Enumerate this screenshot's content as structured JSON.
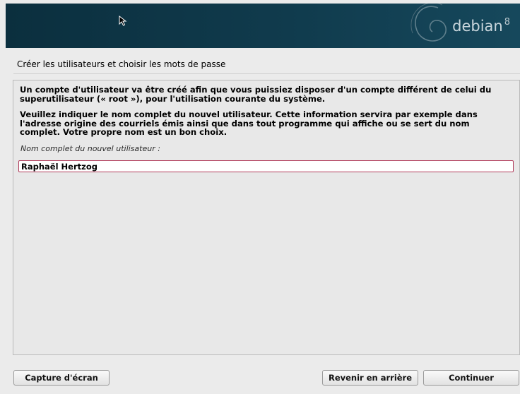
{
  "banner": {
    "logo_text": "debian",
    "logo_version": "8",
    "background": "#103b4d"
  },
  "page": {
    "title": "Créer les utilisateurs et choisir les mots de passe"
  },
  "content": {
    "paragraph1": "Un compte d'utilisateur va être créé afin que vous puissiez disposer d'un compte différent de celui du superutilisateur (« root »), pour l'utilisation courante du système.",
    "paragraph2": "Veuillez indiquer le nom complet du nouvel utilisateur. Cette information servira par exemple dans l'adresse origine des courriels émis ainsi que dans tout programme qui affiche ou se sert du nom complet. Votre propre nom est un bon choix.",
    "field_label": "Nom complet du nouvel utilisateur :",
    "field_value": "Raphaël Hertzog",
    "field_border_color": "#b13a5a"
  },
  "buttons": {
    "screenshot": "Capture d'écran",
    "back": "Revenir en arrière",
    "continue": "Continuer"
  },
  "icons": {
    "banner_logo": "debian-swirl-icon",
    "pointer": "mouse-pointer-icon"
  }
}
